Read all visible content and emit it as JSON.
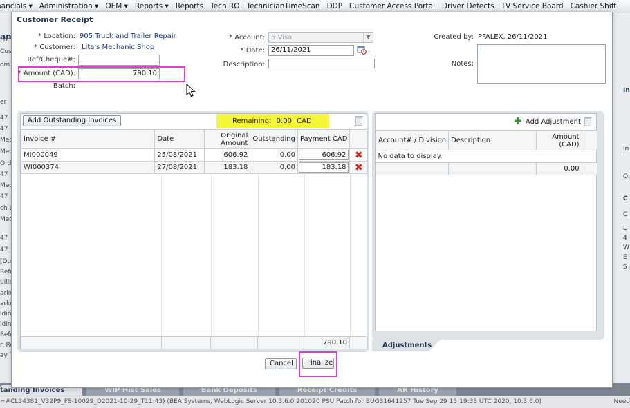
{
  "menubar": {
    "items": [
      "nancials ▾",
      "Administration ▾",
      "OEM ▾",
      "Reports ▾",
      "Reports",
      "Tech RO",
      "TechnicianTimeScan",
      "DDP",
      "Customer Access Portal",
      "Driver Defects",
      "TV Service Board",
      "Cashier Shift"
    ]
  },
  "background": {
    "left_heading": "ano",
    "left_items": [
      "Loc",
      "Custo",
      "om",
      "er",
      "47",
      "47",
      "Mech",
      "Mech",
      "Orde",
      "47",
      "Mech",
      "47",
      "ch Lo",
      "Mech",
      "47",
      "47",
      "[Du",
      "Refri",
      "uille",
      "arke",
      "arke",
      "ldin",
      "ldin",
      "Refri",
      "n Re",
      "ay T"
    ],
    "right_items": [
      "In",
      "In",
      "Oi",
      "C",
      "C",
      "L",
      "4",
      "W",
      "E",
      "S"
    ],
    "tabs": [
      "tanding Invoices",
      "WIP Hist Sales",
      "Bank Deposits",
      "Receipt Credits",
      "AR History"
    ],
    "status_left": "=#CL34381_V32P9_FS-10029_D2021-10-29_T11:43) (BEA Systems, WebLogic Server 10.3.6.0 201020 PSU Patch for BUG31641257 Tue Sep 29 15:19:33 UTC 2020, 10.3.6.0)",
    "status_right": "Need"
  },
  "dialog": {
    "title": "Customer Receipt",
    "location_label": "* Location:",
    "location_value": "905 Truck and Trailer Repair",
    "customer_label": "* Customer:",
    "customer_value": "Lita's Mechanic Shop",
    "ref_label": "Ref/Cheque#:",
    "ref_value": "",
    "amount_label": "* Amount (CAD):",
    "amount_value": "790.10",
    "batch_label": "Batch:",
    "account_label": "* Account:",
    "account_value": "5 Visa",
    "date_label": "* Date:",
    "date_value": "26/11/2021",
    "description_label": "Description:",
    "description_value": "",
    "created_by_label": "Created by:",
    "created_by_value": "PFALEX, 26/11/2021",
    "notes_label": "Notes:",
    "notes_value": ""
  },
  "invoices": {
    "add_button": "Add Outstanding Invoices",
    "remaining_label": "Remaining:",
    "remaining_value": "0.00",
    "remaining_currency": "CAD",
    "columns": {
      "invoice": "Invoice #",
      "date": "Date",
      "original_1": "Original",
      "original_2": "Amount",
      "outstanding": "Outstanding",
      "payment": "Payment CAD"
    },
    "rows": [
      {
        "invoice": "MI000049",
        "date": "25/08/2021",
        "original": "606.92",
        "outstanding": "0.00",
        "payment": "606.92"
      },
      {
        "invoice": "WI000374",
        "date": "27/08/2021",
        "original": "183.18",
        "outstanding": "0.00",
        "payment": "183.18"
      }
    ],
    "total_payment": "790.10"
  },
  "adjustments": {
    "add_button": "Add Adjustment",
    "columns": {
      "account": "Account# / Division",
      "description": "Description",
      "amount_1": "Amount",
      "amount_2": "(CAD)"
    },
    "empty_text": "No data to display.",
    "total": "0.00",
    "tab_label": "Adjustments"
  },
  "footer": {
    "cancel": "Cancel",
    "finalize": "Finalize"
  },
  "colors": {
    "highlight_yellow": "#f5f53a",
    "annotation_magenta": "#e838d8",
    "delete_red": "#d3241b",
    "value_blue": "#1f3d73"
  }
}
